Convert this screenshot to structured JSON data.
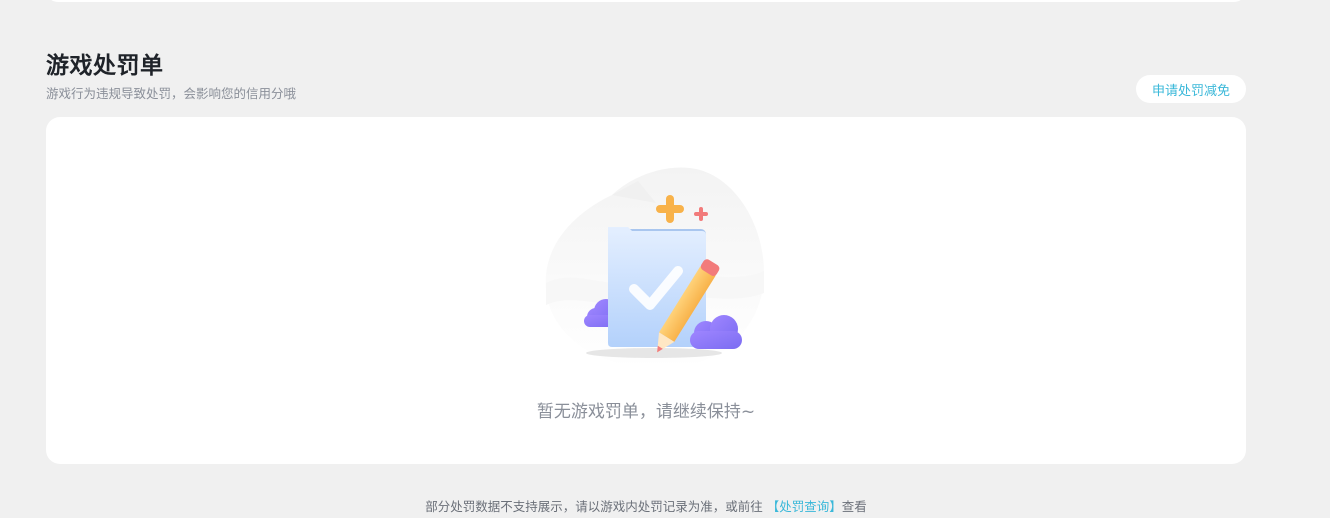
{
  "section": {
    "title": "游戏处罚单",
    "subtitle": "游戏行为违规导致处罚，会影响您的信用分哦",
    "appeal_button_label": "申请处罚减免"
  },
  "empty_state": {
    "message": "暂无游戏罚单，请继续保持~",
    "icon": "clipboard-check-pencil-illustration"
  },
  "footer": {
    "note_prefix": "部分处罚数据不支持展示，请以游戏内处罚记录为准，或前往",
    "link_label": "【处罚查询】",
    "note_suffix": "查看"
  },
  "colors": {
    "background": "#f0f0f0",
    "card": "#ffffff",
    "accent": "#3ab8d9",
    "title": "#1f2329",
    "muted": "#8a8f99"
  }
}
